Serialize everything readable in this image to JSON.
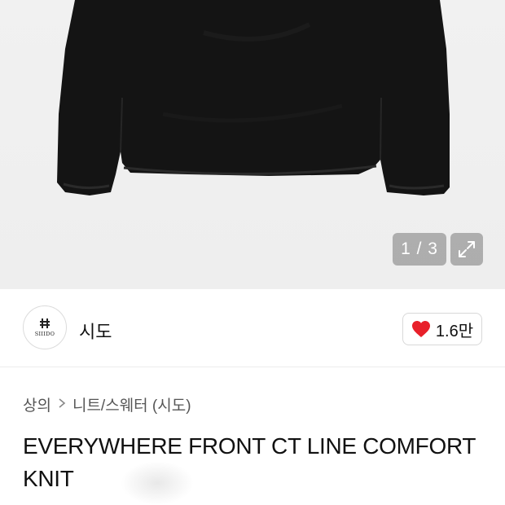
{
  "gallery": {
    "counter": "1 / 3",
    "expand_icon": "expand-icon",
    "background": "#efefef",
    "garment_color": "#141414"
  },
  "brand": {
    "name": "시도",
    "logo_text": "SIIIDO",
    "likes": "1.6만",
    "like_color": "#e8202a"
  },
  "breadcrumb": {
    "category": "상의",
    "subcategory": "니트/스웨터 (시도)"
  },
  "product": {
    "title": "EVERYWHERE FRONT CT LINE COMFORT KNIT"
  }
}
